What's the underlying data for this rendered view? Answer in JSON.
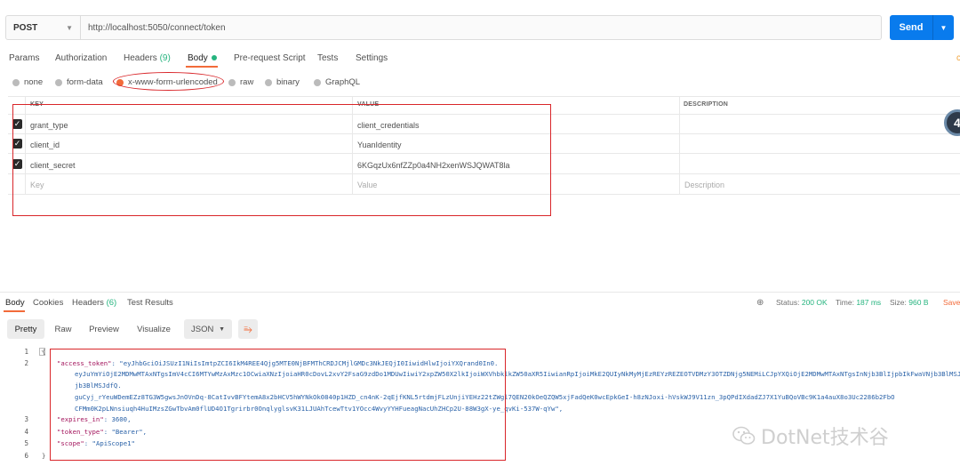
{
  "request": {
    "method": "POST",
    "url": "http://localhost:5050/connect/token",
    "send_label": "Send"
  },
  "req_tabs": {
    "params": "Params",
    "authorization": "Authorization",
    "headers": "Headers",
    "headers_count": "(9)",
    "body": "Body",
    "prerequest": "Pre-request Script",
    "tests": "Tests",
    "settings": "Settings"
  },
  "body_types": {
    "none": "none",
    "form_data": "form-data",
    "urlencoded": "x-www-form-urlencoded",
    "raw": "raw",
    "binary": "binary",
    "graphql": "GraphQL"
  },
  "table": {
    "headers": {
      "key": "KEY",
      "value": "VALUE",
      "description": "DESCRIPTION"
    },
    "rows": [
      {
        "key": "grant_type",
        "value": "client_credentials"
      },
      {
        "key": "client_id",
        "value": "YuanIdentity"
      },
      {
        "key": "client_secret",
        "value": "6KGqzUx6nfZZp0a4NH2xenWSJQWAT8la"
      }
    ],
    "placeholders": {
      "key": "Key",
      "value": "Value",
      "description": "Description"
    }
  },
  "badge_text": "4",
  "response": {
    "tabs": {
      "body": "Body",
      "cookies": "Cookies",
      "headers": "Headers",
      "headers_count": "(6)",
      "test_results": "Test Results"
    },
    "status_label": "Status:",
    "status_value": "200 OK",
    "time_label": "Time:",
    "time_value": "187 ms",
    "size_label": "Size:",
    "size_value": "960 B",
    "save_label": "Save",
    "view_modes": {
      "pretty": "Pretty",
      "raw": "Raw",
      "preview": "Preview",
      "visualize": "Visualize"
    },
    "format": "JSON",
    "line_numbers": [
      "1",
      "2",
      "3",
      "4",
      "5",
      "6"
    ],
    "code": {
      "open": "{",
      "access_key": "\"access_token\"",
      "access_l1": ": \"eyJhbGciOiJSUzI1NiIsImtpZCI6IkM4REE4Qjg5MTE0NjBFMThCRDJCMjlGMDc3NkJEQjI0IiwidHlwIjoiYXQrand0In0.",
      "access_l2": "eyJuYmYiOjE2MDMwMTAxNTgsImV4cCI6MTYwMzAxMzc1OCwiaXNzIjoiaHR0cDovL2xvY2FsaG9zdDo1MDUwIiwiY2xpZW50X2lkIjoiWXVhbklkZW50aXR5IiwianRpIjoiMkE2QUIyNkMyMjEzREYzREZEOTVDMzY3OTZDNjg5NEMiLCJpYXQiOjE2MDMwMTAxNTgsInNjb3BlIjpbIkFwaVNjb3BlMSJdfQ.",
      "access_l3": "jb3BlMSJdfQ.",
      "access_l4": "guCyj_rYeuWDemEZz8TG3W5gwsJnOVnDq-8CatIvvBFYtemA8x2bHCV5hWYNkOk0840p1HZD_cn4nK-2qEjfKNL5rtdmjFLzUnjiYEHz22tZWgl7QEN20kOeQZQW5xjFadQeK0wcEpkGeI-h8zNJoxi-hVskWJ9V11zn_3pQPdIXdadZJ7X1YuBQoVBc9K1a4auX8o3Uc2286b2FbO",
      "access_l5": "CFMm0K2pLNnsiuqh4HuIMzsZGwTbvAm0flUD4O1Tgrirbr0OnqlyglsvK31LJUAhTcewTtv1YOcc4WvyYYHFueagNacUhZHCp2U-88W3gX-ye_qvKi-537W-qYw\",",
      "expires_key": "\"expires_in\"",
      "expires_val": ": 3600,",
      "type_key": "\"token_type\"",
      "type_val": ": \"Bearer\",",
      "scope_key": "\"scope\"",
      "scope_val": ": \"ApiScope1\"",
      "close": "}"
    }
  },
  "watermark": "DotNet技术谷",
  "colors": {
    "accent": "#f26b3a",
    "send": "#097bed",
    "highlight": "#d9262a",
    "success": "#26b47f"
  }
}
